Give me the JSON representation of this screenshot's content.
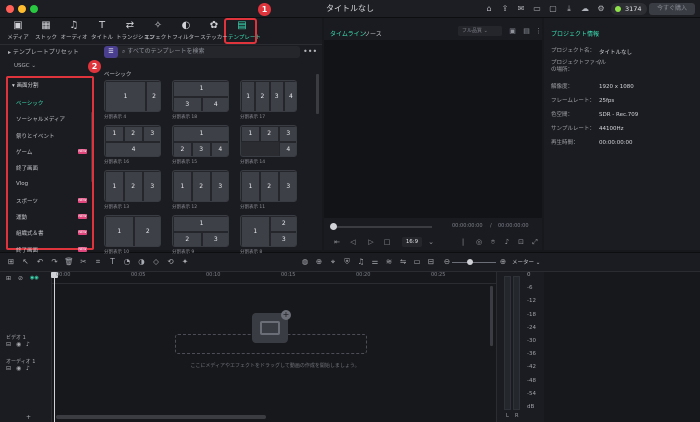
{
  "window": {
    "title": "タイトルなし"
  },
  "titlebar": {
    "credits": "3174",
    "buy_button": "今すぐ購入"
  },
  "toolbar_tabs": [
    {
      "label": "メディア",
      "icon": "media-icon"
    },
    {
      "label": "ストック",
      "icon": "stock-icon"
    },
    {
      "label": "オーディオ",
      "icon": "audio-icon"
    },
    {
      "label": "タイトル",
      "icon": "title-icon"
    },
    {
      "label": "トランジション",
      "icon": "transition-icon"
    },
    {
      "label": "エフェクト",
      "icon": "effect-icon"
    },
    {
      "label": "フィルター",
      "icon": "filter-icon"
    },
    {
      "label": "ステッカー",
      "icon": "sticker-icon"
    },
    {
      "label": "テンプレート",
      "icon": "template-icon",
      "active": true
    }
  ],
  "left_panel": {
    "preset_header": "テンプレートプリセット",
    "usgc": "USGC",
    "category_header": "画面分割",
    "search_placeholder": "すべてのテンプレートを検索",
    "new_badge": "NEW",
    "categories": [
      {
        "label": "ベーシック",
        "active": true,
        "badge": false
      },
      {
        "label": "ソーシャルメディア",
        "active": false,
        "badge": false
      },
      {
        "label": "祭りとイベント",
        "active": false,
        "badge": false
      },
      {
        "label": "ゲーム",
        "active": false,
        "badge": true
      },
      {
        "label": "終了画面",
        "active": false,
        "badge": false
      },
      {
        "label": "Vlog",
        "active": false,
        "badge": false
      },
      {
        "label": "スポーツ",
        "active": false,
        "badge": true
      },
      {
        "label": "運動",
        "active": false,
        "badge": true
      },
      {
        "label": "組織式＆書",
        "active": false,
        "badge": true
      },
      {
        "label": "終了画面",
        "active": false,
        "badge": true
      }
    ],
    "section_title": "ベーシック",
    "templates": [
      {
        "caption": "分割表示 4"
      },
      {
        "caption": "分割表示 18"
      },
      {
        "caption": "分割表示 17"
      },
      {
        "caption": "分割表示 16"
      },
      {
        "caption": "分割表示 15"
      },
      {
        "caption": "分割表示 14"
      },
      {
        "caption": "分割表示 13"
      },
      {
        "caption": "分割表示 12"
      },
      {
        "caption": "分割表示 11"
      },
      {
        "caption": "分割表示 10"
      },
      {
        "caption": "分割表示 9"
      },
      {
        "caption": "分割表示 8"
      }
    ]
  },
  "preview": {
    "tab_timeline": "タイムライン",
    "tab_source": "ソース",
    "quality": "フル品質",
    "timecode_current": "00:00:00:00",
    "timecode_total": "00:00:00:00",
    "ratio": "16:9"
  },
  "project_info": {
    "header": "プロジェクト情報",
    "rows": [
      {
        "key": "プロジェクト名：",
        "value": "タイトルなし"
      },
      {
        "key": "プロジェクトファイルの場所：",
        "value": "/"
      },
      {
        "key": "解像度：",
        "value": "1920 x 1080"
      },
      {
        "key": "フレームレート：",
        "value": "25fps"
      },
      {
        "key": "色空間：",
        "value": "SDR - Rec.709"
      },
      {
        "key": "サンプルレート：",
        "value": "44100Hz"
      },
      {
        "key": "再生時間：",
        "value": "00:00:00:00"
      }
    ]
  },
  "timeline": {
    "meter_label": "メーター",
    "ruler": [
      "00:00",
      "00:05",
      "00:10",
      "00:15",
      "00:20",
      "00:25"
    ],
    "tracks": [
      {
        "label": "ビデオ 1"
      },
      {
        "label": "オーディオ 1"
      }
    ],
    "drop_text": "ここにメディアやエフェクトをドラッグして動画の作成を開始しましょう。",
    "meter_db": [
      "0",
      "-6",
      "-12",
      "-18",
      "-24",
      "-30",
      "-36",
      "-42",
      "-48",
      "-54",
      "dB"
    ],
    "meter_channels": [
      "L",
      "R"
    ]
  },
  "annotations": [
    {
      "number": "1"
    },
    {
      "number": "2"
    }
  ],
  "colors": {
    "accent": "#3be0b5",
    "highlight": "#e0343c",
    "badge": "#e0457b"
  }
}
